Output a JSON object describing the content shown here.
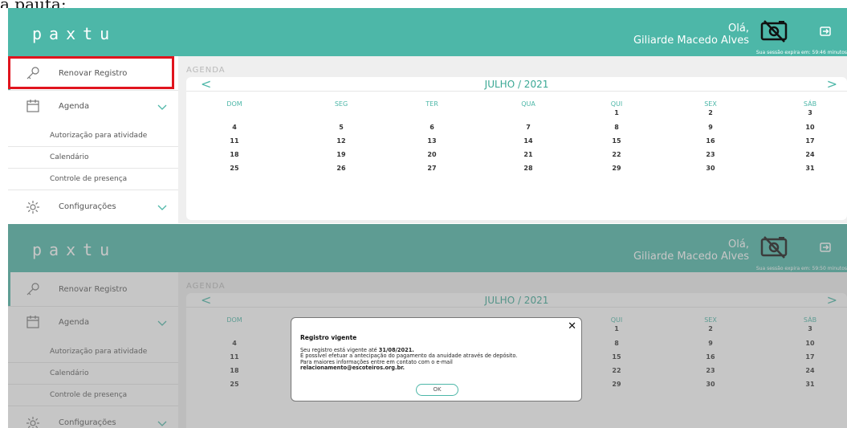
{
  "caption": "a pauta:",
  "app": {
    "logo": "paxtu",
    "greeting": "Olá,",
    "user_name": "Giliarde Macedo Alves",
    "accent": "#4db7a8"
  },
  "panels": [
    {
      "session": "Sua sessão expira em: 59:46 minutos"
    },
    {
      "session": "Sua sessão expira em: 59:50 minutos"
    }
  ],
  "sidebar": {
    "renew": "Renovar Registro",
    "agenda": "Agenda",
    "sub": [
      "Autorização para atividade",
      "Calendário",
      "Controle de presença"
    ],
    "settings": "Configurações"
  },
  "breadcrumb": "AGENDA",
  "calendar": {
    "month": "JULHO / 2021",
    "prev": "<",
    "next": ">",
    "weekdays": [
      "DOM",
      "SEG",
      "TER",
      "QUA",
      "QUI",
      "SEX",
      "SÁB"
    ],
    "weeks": [
      [
        "",
        "",
        "",
        "",
        "1",
        "2",
        "3"
      ],
      [
        "4",
        "5",
        "6",
        "7",
        "8",
        "9",
        "10"
      ],
      [
        "11",
        "12",
        "13",
        "14",
        "15",
        "16",
        "17"
      ],
      [
        "18",
        "19",
        "20",
        "21",
        "22",
        "23",
        "24"
      ],
      [
        "25",
        "26",
        "27",
        "28",
        "29",
        "30",
        "31"
      ]
    ]
  },
  "modal": {
    "close": "✕",
    "title": "Registro vigente",
    "line1_prefix": "Seu registro está vigente até ",
    "line1_date": "31/08/2021.",
    "line2": "É possível efetuar a antecipação do pagamento da anuidade através de depósito.",
    "line3": "Para maiores informações entre em contato com o e-mail",
    "email": "relacionamento@escoteiros.org.br.",
    "ok": "OK"
  }
}
